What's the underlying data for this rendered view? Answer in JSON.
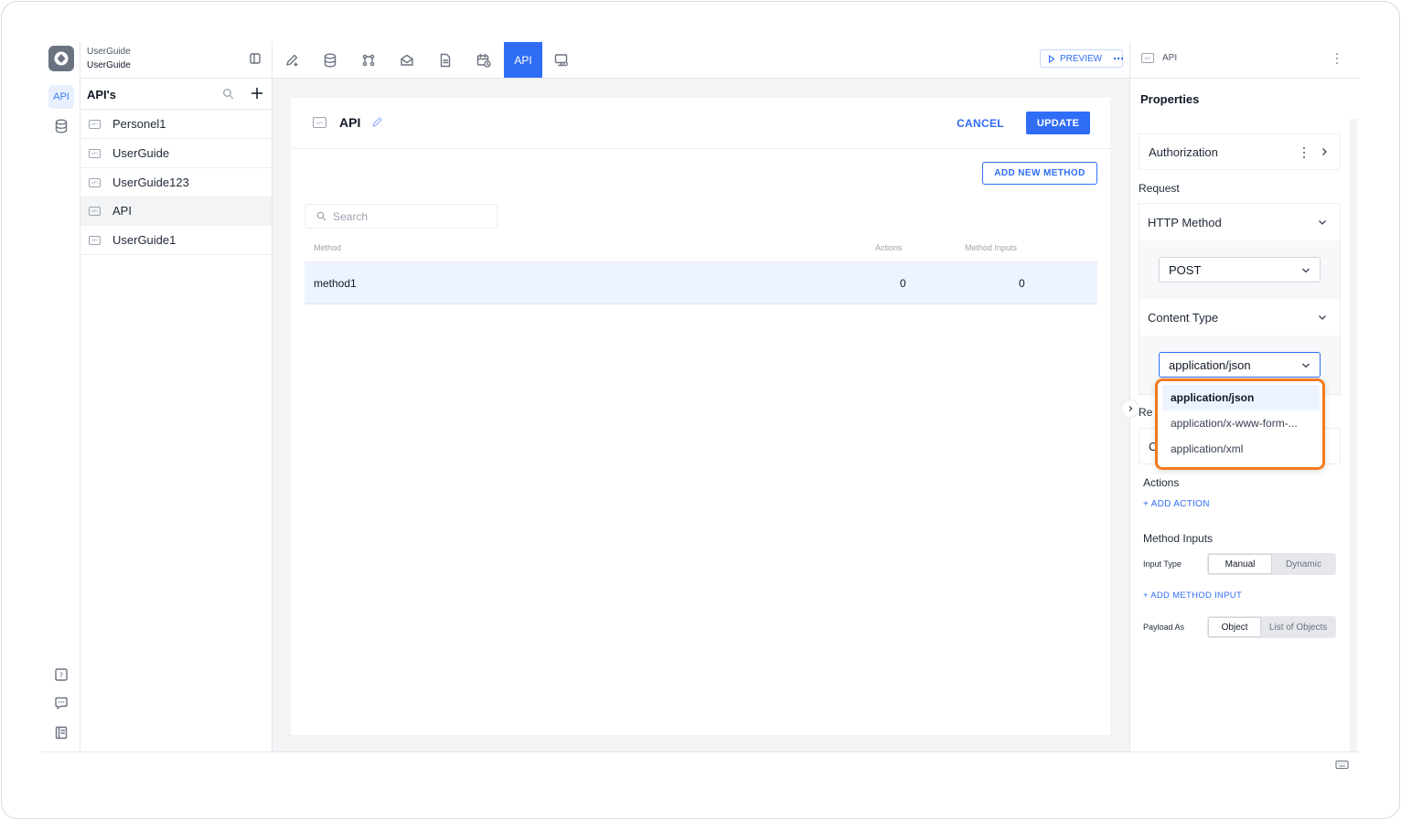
{
  "app": {
    "name_line1": "UserGuide",
    "name_line2": "UserGuide"
  },
  "rail": {
    "api_label": "API"
  },
  "list_panel": {
    "title": "API's",
    "items": [
      {
        "label": "Personel1",
        "active": false
      },
      {
        "label": "UserGuide",
        "active": false
      },
      {
        "label": "UserGuide123",
        "active": false
      },
      {
        "label": "API",
        "active": true
      },
      {
        "label": "UserGuide1",
        "active": false
      }
    ]
  },
  "toolbar": {
    "active_tab": "API",
    "preview_label": "PREVIEW"
  },
  "main": {
    "title": "API",
    "cancel_label": "CANCEL",
    "update_label": "UPDATE",
    "add_method_label": "ADD NEW METHOD",
    "search_placeholder": "Search",
    "columns": [
      "Method",
      "Actions",
      "Method Inputs"
    ],
    "rows": [
      {
        "method": "method1",
        "actions": "0",
        "inputs": "0"
      }
    ]
  },
  "properties": {
    "header_label": "API",
    "title": "Properties",
    "authorization_label": "Authorization",
    "request_label": "Request",
    "http_method_label": "HTTP Method",
    "http_method_value": "POST",
    "content_type_label": "Content Type",
    "content_type_value": "application/json",
    "content_type_options": [
      "application/json",
      "application/x-www-form-...",
      "application/xml"
    ],
    "hidden_partial_label": "Re",
    "hidden_partial_box": "C",
    "actions_label": "Actions",
    "add_action_label": "+ ADD ACTION",
    "method_inputs_label": "Method Inputs",
    "input_type_label": "Input Type",
    "input_type_options": [
      "Manual",
      "Dynamic"
    ],
    "input_type_selected": "Manual",
    "add_method_input_label": "+ ADD METHOD INPUT",
    "payload_as_label": "Payload As",
    "payload_options": [
      "Object",
      "List of Objects"
    ],
    "payload_selected": "Object"
  },
  "colors": {
    "accent": "#2f6df6",
    "highlight": "#f47b20"
  }
}
